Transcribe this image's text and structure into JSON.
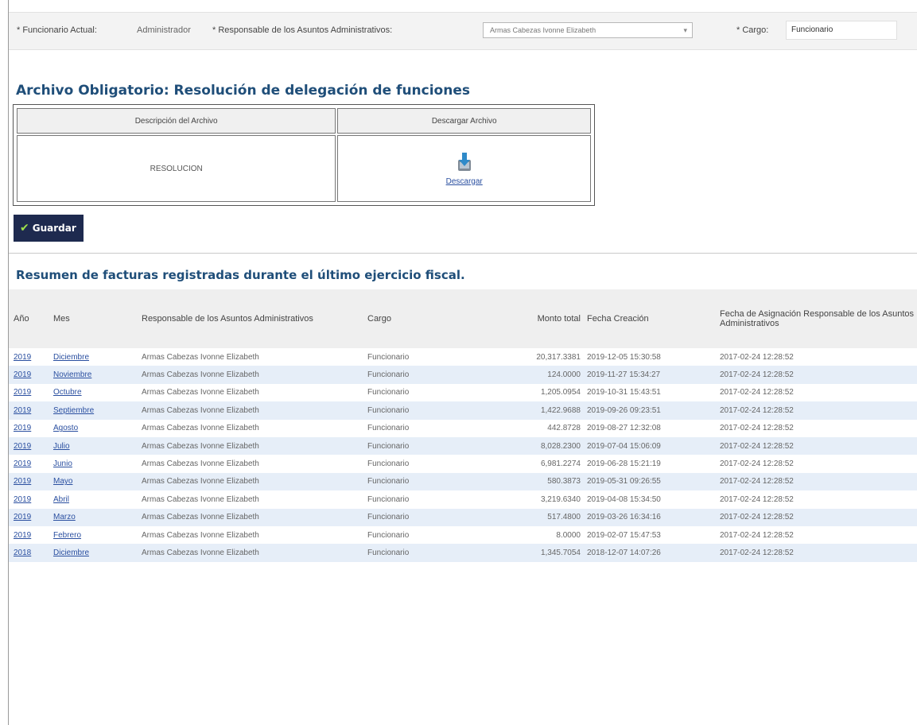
{
  "header": {
    "funcionario_label": "* Funcionario Actual:",
    "funcionario_value": "Administrador",
    "responsable_label": "* Responsable de los Asuntos Administrativos:",
    "responsable_value": "Armas Cabezas Ivonne Elizabeth",
    "cargo_label": "* Cargo:",
    "cargo_value": "Funcionario"
  },
  "archivo": {
    "title": "Archivo Obligatorio: Resolución de delegación de funciones",
    "col_descripcion": "Descripción del Archivo",
    "col_descargar": "Descargar Archivo",
    "descripcion": "RESOLUCION",
    "download_label": "Descargar"
  },
  "guardar_label": "Guardar",
  "resumen": {
    "title": "Resumen de facturas registradas durante el último ejercicio fiscal.",
    "headers": {
      "anio": "Año",
      "mes": "Mes",
      "responsable": "Responsable de los Asuntos Administrativos",
      "cargo": "Cargo",
      "monto": "Monto total",
      "fecha_creacion": "Fecha Creación",
      "fecha_asignacion": "Fecha de Asignación Responsable de los Asuntos Administrativos"
    },
    "rows": [
      {
        "anio": "2019",
        "mes": "Diciembre",
        "responsable": "Armas Cabezas Ivonne Elizabeth",
        "cargo": "Funcionario",
        "monto": "20,317.3381",
        "fecha_creacion": "2019-12-05 15:30:58",
        "fecha_asignacion": "2017-02-24 12:28:52"
      },
      {
        "anio": "2019",
        "mes": "Noviembre",
        "responsable": "Armas Cabezas Ivonne Elizabeth",
        "cargo": "Funcionario",
        "monto": "124.0000",
        "fecha_creacion": "2019-11-27 15:34:27",
        "fecha_asignacion": "2017-02-24 12:28:52"
      },
      {
        "anio": "2019",
        "mes": "Octubre",
        "responsable": "Armas Cabezas Ivonne Elizabeth",
        "cargo": "Funcionario",
        "monto": "1,205.0954",
        "fecha_creacion": "2019-10-31 15:43:51",
        "fecha_asignacion": "2017-02-24 12:28:52"
      },
      {
        "anio": "2019",
        "mes": "Septiembre",
        "responsable": "Armas Cabezas Ivonne Elizabeth",
        "cargo": "Funcionario",
        "monto": "1,422.9688",
        "fecha_creacion": "2019-09-26 09:23:51",
        "fecha_asignacion": "2017-02-24 12:28:52"
      },
      {
        "anio": "2019",
        "mes": "Agosto",
        "responsable": "Armas Cabezas Ivonne Elizabeth",
        "cargo": "Funcionario",
        "monto": "442.8728",
        "fecha_creacion": "2019-08-27 12:32:08",
        "fecha_asignacion": "2017-02-24 12:28:52"
      },
      {
        "anio": "2019",
        "mes": "Julio",
        "responsable": "Armas Cabezas Ivonne Elizabeth",
        "cargo": "Funcionario",
        "monto": "8,028.2300",
        "fecha_creacion": "2019-07-04 15:06:09",
        "fecha_asignacion": "2017-02-24 12:28:52"
      },
      {
        "anio": "2019",
        "mes": "Junio",
        "responsable": "Armas Cabezas Ivonne Elizabeth",
        "cargo": "Funcionario",
        "monto": "6,981.2274",
        "fecha_creacion": "2019-06-28 15:21:19",
        "fecha_asignacion": "2017-02-24 12:28:52"
      },
      {
        "anio": "2019",
        "mes": "Mayo",
        "responsable": "Armas Cabezas Ivonne Elizabeth",
        "cargo": "Funcionario",
        "monto": "580.3873",
        "fecha_creacion": "2019-05-31 09:26:55",
        "fecha_asignacion": "2017-02-24 12:28:52"
      },
      {
        "anio": "2019",
        "mes": "Abril",
        "responsable": "Armas Cabezas Ivonne Elizabeth",
        "cargo": "Funcionario",
        "monto": "3,219.6340",
        "fecha_creacion": "2019-04-08 15:34:50",
        "fecha_asignacion": "2017-02-24 12:28:52"
      },
      {
        "anio": "2019",
        "mes": "Marzo",
        "responsable": "Armas Cabezas Ivonne Elizabeth",
        "cargo": "Funcionario",
        "monto": "517.4800",
        "fecha_creacion": "2019-03-26 16:34:16",
        "fecha_asignacion": "2017-02-24 12:28:52"
      },
      {
        "anio": "2019",
        "mes": "Febrero",
        "responsable": "Armas Cabezas Ivonne Elizabeth",
        "cargo": "Funcionario",
        "monto": "8.0000",
        "fecha_creacion": "2019-02-07 15:47:53",
        "fecha_asignacion": "2017-02-24 12:28:52"
      },
      {
        "anio": "2018",
        "mes": "Diciembre",
        "responsable": "Armas Cabezas Ivonne Elizabeth",
        "cargo": "Funcionario",
        "monto": "1,345.7054",
        "fecha_creacion": "2018-12-07 14:07:26",
        "fecha_asignacion": "2017-02-24 12:28:52"
      }
    ]
  },
  "colors": {
    "title": "#1f4e79",
    "button_bg": "#1e2a4f",
    "check": "#9ee04a",
    "row_alt": "#e6eef8",
    "link": "#2a4fa0"
  },
  "icons": {
    "download": "download-file-icon",
    "check": "check-icon",
    "dropdown": "chevron-down-icon"
  }
}
